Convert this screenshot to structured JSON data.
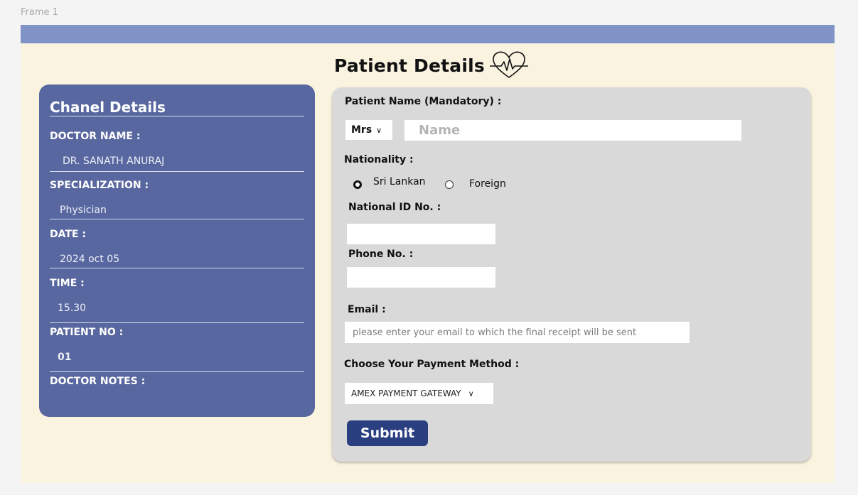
{
  "frame_label": "Frame 1",
  "page_title": "Patient Details",
  "colors": {
    "top_bar": "#7f93c6",
    "frame_background": "#f9f3df",
    "channel_panel": "#58679f",
    "form_panel": "#d9d9d9",
    "submit_button": "#2a3f80"
  },
  "channel": {
    "title": "Chanel Details",
    "doctor_name_label": "DOCTOR NAME :",
    "doctor_name": "DR. SANATH ANURAJ",
    "specialization_label": "SPECIALIZATION :",
    "specialization": "Physician",
    "date_label": "DATE :",
    "date": "2024 oct 05",
    "time_label": "TIME :",
    "time": "15.30",
    "patient_no_label": "PATIENT NO :",
    "patient_no": "01",
    "doctor_notes_label": "DOCTOR NOTES :"
  },
  "form": {
    "patient_name_label": "Patient Name (Mandatory) :",
    "title_select": "Mrs",
    "name_placeholder": "Name",
    "nationality_label": "Nationality  :",
    "nationality_options": [
      "Sri Lankan",
      "Foreign"
    ],
    "nationality_selected": "Sri Lankan",
    "national_id_label": "National ID No.  :",
    "national_id_value": "",
    "phone_label": "Phone No.  :",
    "phone_value": "",
    "email_label": "Email :",
    "email_placeholder": "please enter your email  to which the final receipt will be sent",
    "payment_label": "Choose Your Payment Method :",
    "payment_selected": "AMEX PAYMENT GATEWAY",
    "submit_label": "Submit"
  }
}
